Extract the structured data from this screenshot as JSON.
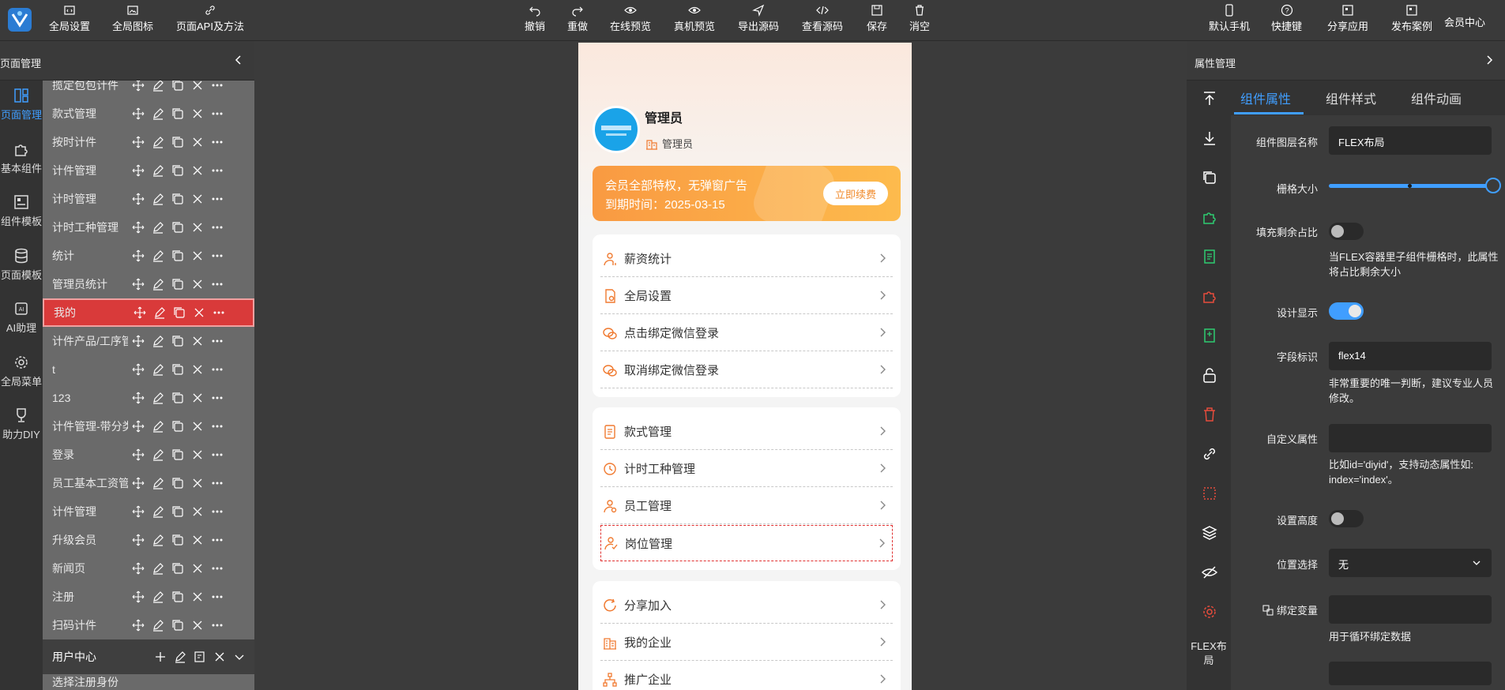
{
  "topbar": {
    "left": [
      {
        "label": "全局设置",
        "icon": "code-window-icon"
      },
      {
        "label": "全局图标",
        "icon": "image-icon"
      },
      {
        "label": "页面API及方法",
        "icon": "link-icon"
      }
    ],
    "center": [
      {
        "label": "撤销",
        "icon": "undo-icon"
      },
      {
        "label": "重做",
        "icon": "redo-icon"
      },
      {
        "label": "在线预览",
        "icon": "eye-icon"
      },
      {
        "label": "真机预览",
        "icon": "eye-icon"
      },
      {
        "label": "导出源码",
        "icon": "send-icon"
      },
      {
        "label": "查看源码",
        "icon": "code-icon"
      },
      {
        "label": "保存",
        "icon": "save-icon"
      },
      {
        "label": "消空",
        "icon": "trash-icon"
      }
    ],
    "right": [
      {
        "label": "默认手机",
        "icon": "phone-icon"
      },
      {
        "label": "快捷键",
        "icon": "help-icon"
      },
      {
        "label": "分享应用",
        "icon": "share-icon"
      },
      {
        "label": "发布案例",
        "icon": "publish-icon"
      }
    ],
    "member": "会员中心"
  },
  "leftnav": [
    {
      "label": "页面管理",
      "icon": "layout-icon",
      "active": true
    },
    {
      "label": "基本组件",
      "icon": "puzzle-icon",
      "active": false
    },
    {
      "label": "组件模板",
      "icon": "template-icon",
      "active": false
    },
    {
      "label": "页面模板",
      "icon": "database-icon",
      "active": false
    },
    {
      "label": "AI助理",
      "icon": "ai-chip-icon",
      "active": false
    },
    {
      "label": "全局菜单",
      "icon": "gear-icon",
      "active": false
    },
    {
      "label": "助力DIY",
      "icon": "trophy-icon",
      "active": false
    }
  ],
  "page_panel": {
    "title": "页面管理",
    "pages": [
      "揽定包包计件",
      "款式管理",
      "按时计件",
      "计件管理",
      "计时管理",
      "计时工种管理",
      "统计",
      "管理员统计",
      "我的",
      "计件产品/工序管",
      "t",
      "123",
      "计件管理-带分类",
      "登录",
      "员工基本工资管",
      "计件管理",
      "升级会员",
      "新闻页",
      "注册",
      "扫码计件"
    ],
    "selected_index": 8,
    "group": "用户中心",
    "tail": "选择注册身份"
  },
  "phone": {
    "user_name": "管理员",
    "user_role": "管理员",
    "vip_line1": "会员全部特权，无弹窗广告",
    "vip_line2": "到期时间：2025-03-15",
    "vip_button": "立即续费",
    "card1": [
      {
        "label": "薪资统计",
        "icon": "user-stat-icon"
      },
      {
        "label": "全局设置",
        "icon": "doc-settings-icon"
      },
      {
        "label": "点击绑定微信登录",
        "icon": "wechat-icon"
      },
      {
        "label": "取消绑定微信登录",
        "icon": "wechat-icon"
      }
    ],
    "card2": [
      {
        "label": "款式管理",
        "icon": "list-doc-icon"
      },
      {
        "label": "计时工种管理",
        "icon": "clock-tool-icon"
      },
      {
        "label": "员工管理",
        "icon": "user-gear-icon"
      },
      {
        "label": "岗位管理",
        "icon": "user-check-icon"
      }
    ],
    "card3": [
      {
        "label": "分享加入",
        "icon": "share-circle-icon"
      },
      {
        "label": "我的企业",
        "icon": "building-icon"
      },
      {
        "label": "推广企业",
        "icon": "network-icon"
      }
    ],
    "accent": "#f07a30"
  },
  "right_panel": {
    "title": "属性管理",
    "tabs": [
      "组件属性",
      "组件样式",
      "组件动画"
    ],
    "active_tab": 0,
    "layer_name_label": "组件图层名称",
    "layer_name_value": "FLEX布局",
    "grid_size_label": "栅格大小",
    "grid_size_fraction": 1.0,
    "fill_ratio_label": "填充剩余占比",
    "fill_ratio_hint": "当FLEX容器里子组件栅格时，此属性将占比剩余大小",
    "design_show_label": "设计显示",
    "design_show_on": true,
    "field_id_label": "字段标识",
    "field_id_value": "flex14",
    "field_id_hint": "非常重要的唯一判断，建议专业人员修改。",
    "custom_attr_label": "自定义属性",
    "custom_attr_value": "",
    "custom_attr_hint": "比如id='diyid'，支持动态属性如: index='index'。",
    "height_label": "设置高度",
    "height_on": false,
    "position_label": "位置选择",
    "position_value": "无",
    "bind_var_label": "绑定变量",
    "bind_var_value": "",
    "bind_var_hint": "用于循环绑定数据",
    "rtool_label": "FLEX布局"
  },
  "colors": {
    "accent": "#409eff",
    "danger": "#d93a3a",
    "success": "#2ecc71"
  }
}
